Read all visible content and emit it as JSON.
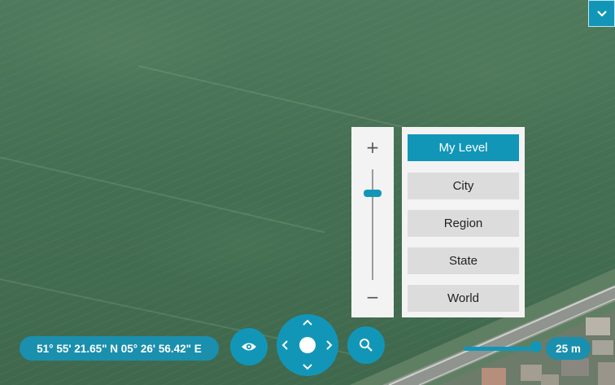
{
  "map": {
    "type": "satellite"
  },
  "coordinates": "51° 55' 21.65\" N 05° 26' 56.42\" E",
  "zoom": {
    "level": 0.8,
    "plus_label": "+",
    "minus_label": "−"
  },
  "levels": {
    "active": "My Level",
    "items": [
      "My Level",
      "City",
      "Region",
      "State",
      "World"
    ]
  },
  "scale": "25 m",
  "icons": {
    "panel_toggle": "chevron-down-icon",
    "view": "eye-icon",
    "search": "search-icon",
    "pan": "directional-pad-icon"
  },
  "colors": {
    "accent": "#1296b8",
    "panel": "#f3f3f3",
    "button": "#dcdcdc"
  }
}
